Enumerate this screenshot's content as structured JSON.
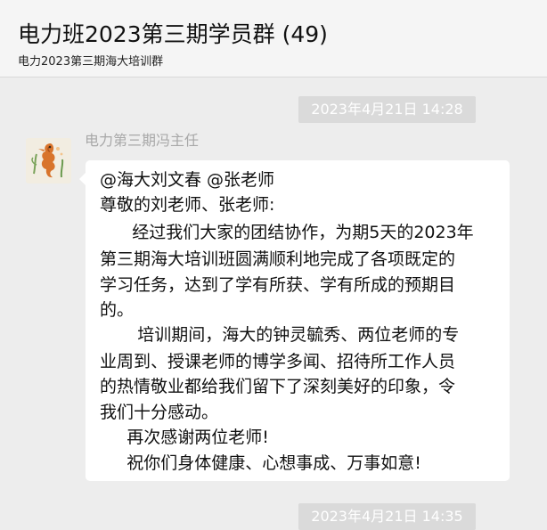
{
  "header": {
    "title": "电力班2023第三期学员群 (49)",
    "subtitle": "电力2023第三期海大培训群"
  },
  "timestamps": {
    "first": "2023年4月21日 14:28",
    "second": "2023年4月21日 14:35"
  },
  "message": {
    "sender": "电力第三期冯主任",
    "lines": [
      "@海大刘文春 @张老师",
      "尊敬的刘老师、张老师:",
      "      经过我们大家的团结协作，为期5天的2023年",
      "第三期海大培训班圆满顺利地完成了各项既定的",
      "学习任务，达到了学有所获、学有所成的预期目",
      "的。",
      "       培训期间，海大的钟灵毓秀、两位老师的专",
      "业周到、授课老师的博学多闻、招待所工作人员",
      "的热情敬业都给我们留下了深刻美好的印象，令",
      "我们十分感动。",
      "     再次感谢两位老师!",
      "     祝你们身体健康、心想事成、万事如意!"
    ]
  },
  "colors": {
    "background": "#ededed",
    "bubble": "#ffffff",
    "timestamp_bg": "#dadada"
  }
}
